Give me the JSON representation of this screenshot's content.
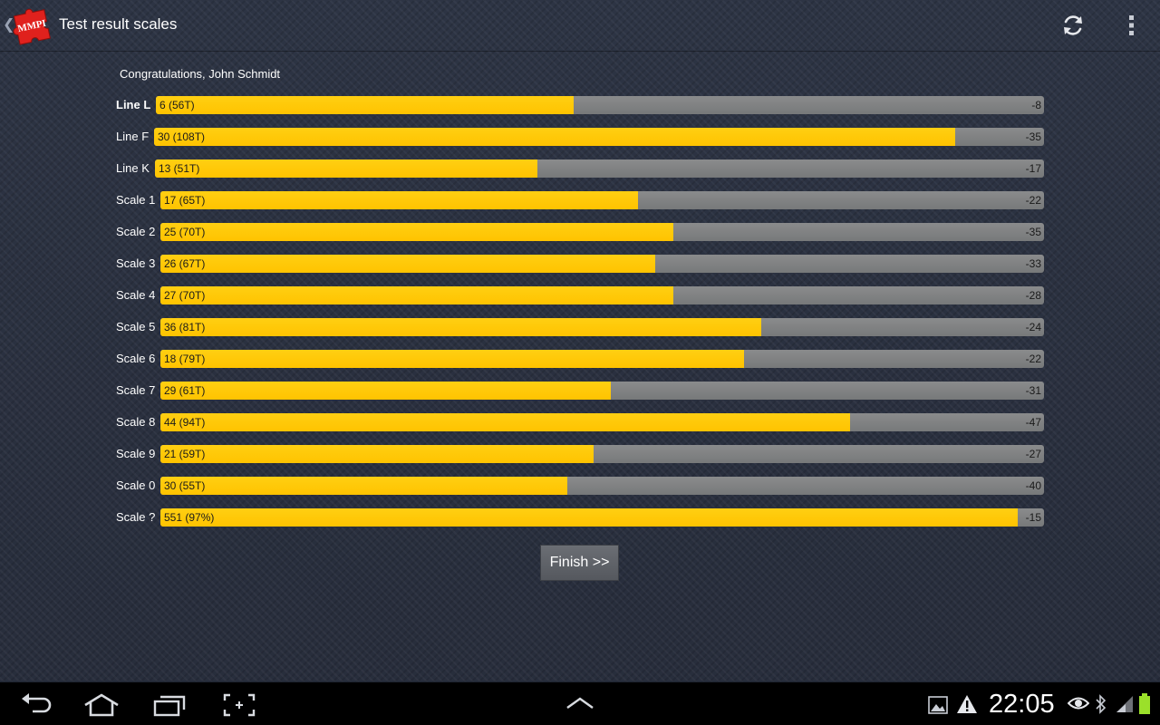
{
  "app": {
    "title": "Test result scales",
    "icon_text": "MMPI",
    "brand_color": "#e0211d"
  },
  "greeting": "Congratulations, John Schmidt",
  "accent_colors": {
    "fill": "#ffc300",
    "track": "#808182"
  },
  "scales": [
    {
      "label": "Line L",
      "bold": true,
      "value_text": "6 (56T)",
      "max_text": "-8",
      "fill_fraction": 0.47
    },
    {
      "label": "Line F",
      "bold": false,
      "value_text": "30 (108T)",
      "max_text": "-35",
      "fill_fraction": 0.9
    },
    {
      "label": "Line K",
      "bold": false,
      "value_text": "13 (51T)",
      "max_text": "-17",
      "fill_fraction": 0.43
    },
    {
      "label": "Scale 1",
      "bold": false,
      "value_text": "17 (65T)",
      "max_text": "-22",
      "fill_fraction": 0.54
    },
    {
      "label": "Scale 2",
      "bold": false,
      "value_text": "25 (70T)",
      "max_text": "-35",
      "fill_fraction": 0.58
    },
    {
      "label": "Scale 3",
      "bold": false,
      "value_text": "26 (67T)",
      "max_text": "-33",
      "fill_fraction": 0.56
    },
    {
      "label": "Scale 4",
      "bold": false,
      "value_text": "27 (70T)",
      "max_text": "-28",
      "fill_fraction": 0.58
    },
    {
      "label": "Scale 5",
      "bold": false,
      "value_text": "36 (81T)",
      "max_text": "-24",
      "fill_fraction": 0.68
    },
    {
      "label": "Scale 6",
      "bold": false,
      "value_text": "18 (79T)",
      "max_text": "-22",
      "fill_fraction": 0.66
    },
    {
      "label": "Scale 7",
      "bold": false,
      "value_text": "29 (61T)",
      "max_text": "-31",
      "fill_fraction": 0.51
    },
    {
      "label": "Scale 8",
      "bold": false,
      "value_text": "44 (94T)",
      "max_text": "-47",
      "fill_fraction": 0.78
    },
    {
      "label": "Scale 9",
      "bold": false,
      "value_text": "21 (59T)",
      "max_text": "-27",
      "fill_fraction": 0.49
    },
    {
      "label": "Scale 0",
      "bold": false,
      "value_text": "30 (55T)",
      "max_text": "-40",
      "fill_fraction": 0.46
    },
    {
      "label": "Scale ?",
      "bold": false,
      "value_text": "551 (97%)",
      "max_text": "-15",
      "fill_fraction": 0.97
    }
  ],
  "finish_label": "Finish >>",
  "actionbar_icons": [
    "refresh-icon",
    "overflow-menu-icon"
  ],
  "navbar": {
    "icons": [
      "back-icon",
      "home-icon",
      "recent-apps-icon",
      "screenshot-icon",
      "up-chevron-icon"
    ],
    "status_icons": [
      "gallery-icon",
      "warning-icon",
      "eye-icon",
      "bluetooth-icon",
      "signal-icon",
      "battery-icon"
    ],
    "time": "22:05"
  }
}
